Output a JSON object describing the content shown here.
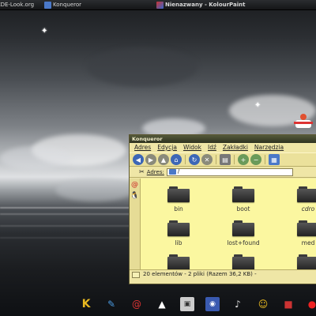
{
  "taskbar": {
    "items": [
      {
        "label": "KDE-Look.org",
        "icon": "browser-icon"
      },
      {
        "label": "Konqueror",
        "icon": "konqueror-icon"
      },
      {
        "label": "Nienazwany - KolourPaint",
        "icon": "kolourpaint-icon"
      }
    ]
  },
  "window": {
    "title": "Konqueror",
    "menu": [
      "Adres",
      "Edycja",
      "Widok",
      "Idź",
      "Zakładki",
      "Narzędzia"
    ],
    "location_label": "Adres:",
    "location_value": "/",
    "files": [
      {
        "name": "bin"
      },
      {
        "name": "boot"
      },
      {
        "name": "cdro"
      },
      {
        "name": "lib"
      },
      {
        "name": "lost+found"
      },
      {
        "name": "med"
      },
      {
        "name": ""
      },
      {
        "name": ""
      },
      {
        "name": ""
      }
    ],
    "status": "20 elementów - 2 pliki (Razem 36,2 KB) -"
  },
  "dock": {
    "icons": [
      "k-menu-icon",
      "broom-icon",
      "debian-icon",
      "tux-icon",
      "kdm-icon",
      "network-icon",
      "music-icon",
      "smiley-icon",
      "game-icon",
      "red-app-icon"
    ]
  },
  "colors": {
    "window_bg": "#efe6a6",
    "file_area_bg": "#fbf7a0",
    "titlebar": "#3a3e28"
  }
}
